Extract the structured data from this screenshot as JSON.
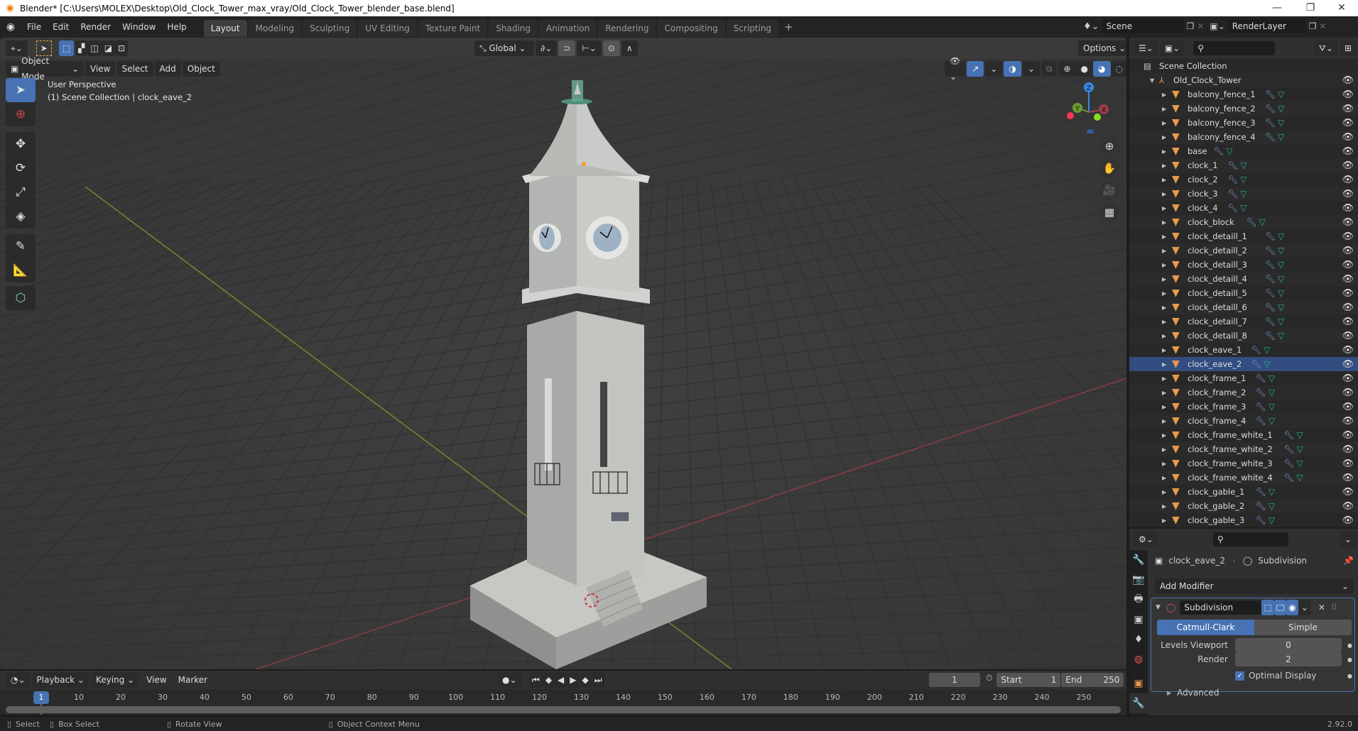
{
  "window": {
    "title": "Blender* [C:\\Users\\MOLEX\\Desktop\\Old_Clock_Tower_max_vray/Old_Clock_Tower_blender_base.blend]",
    "controls": [
      "—",
      "❐",
      "✕"
    ]
  },
  "menu": [
    "File",
    "Edit",
    "Render",
    "Window",
    "Help"
  ],
  "workspaces": [
    {
      "label": "Layout",
      "active": true
    },
    {
      "label": "Modeling"
    },
    {
      "label": "Sculpting"
    },
    {
      "label": "UV Editing"
    },
    {
      "label": "Texture Paint"
    },
    {
      "label": "Shading"
    },
    {
      "label": "Animation"
    },
    {
      "label": "Rendering"
    },
    {
      "label": "Compositing"
    },
    {
      "label": "Scripting"
    }
  ],
  "add_workspace": "+",
  "scene": {
    "name": "Scene",
    "view_layer": "RenderLayer"
  },
  "viewport": {
    "transform_orientation": "Global",
    "options_label": "Options",
    "mode": "Object Mode",
    "header_menus": [
      "View",
      "Select",
      "Add",
      "Object"
    ],
    "overlay_title": "User Perspective",
    "overlay_subtitle": "(1) Scene Collection | clock_eave_2",
    "gizmo_axes": {
      "x": "X",
      "y": "Y",
      "z": "Z"
    },
    "colors": {
      "x_axis": "#a03d4a",
      "y_axis": "#6b9a2f",
      "accent": "#4772b3"
    }
  },
  "tools": [
    "select-box",
    "cursor",
    "move",
    "rotate",
    "scale",
    "transform",
    "annotate",
    "measure",
    "add-cube"
  ],
  "outliner": {
    "root": "Scene Collection",
    "collection": "Old_Clock_Tower",
    "selected": "clock_eave_2",
    "items": [
      "balcony_fence_1",
      "balcony_fence_2",
      "balcony_fence_3",
      "balcony_fence_4",
      "base",
      "clock_1",
      "clock_2",
      "clock_3",
      "clock_4",
      "clock_block",
      "clock_detaill_1",
      "clock_detaill_2",
      "clock_detaill_3",
      "clock_detaill_4",
      "clock_detaill_5",
      "clock_detaill_6",
      "clock_detaill_7",
      "clock_detaill_8",
      "clock_eave_1",
      "clock_eave_2",
      "clock_frame_1",
      "clock_frame_2",
      "clock_frame_3",
      "clock_frame_4",
      "clock_frame_white_1",
      "clock_frame_white_2",
      "clock_frame_white_3",
      "clock_frame_white_4",
      "clock_gable_1",
      "clock_gable_2",
      "clock_gable_3"
    ]
  },
  "properties": {
    "object": "clock_eave_2",
    "modifier_crumb": "Subdivision",
    "add_modifier": "Add Modifier",
    "modifier_name": "Subdivision",
    "type_options": [
      {
        "label": "Catmull-Clark",
        "active": true
      },
      {
        "label": "Simple"
      }
    ],
    "levels_viewport_label": "Levels Viewport",
    "levels_viewport": "0",
    "render_label": "Render",
    "render_levels": "2",
    "optimal_display_label": "Optimal Display",
    "optimal_display": true,
    "advanced_label": "Advanced"
  },
  "timeline": {
    "menus": [
      "Playback",
      "Keying",
      "View",
      "Marker"
    ],
    "current_frame": "1",
    "start_label": "Start",
    "start": "1",
    "end_label": "End",
    "end": "250",
    "ticks": [
      "10",
      "20",
      "30",
      "40",
      "50",
      "60",
      "70",
      "80",
      "90",
      "100",
      "110",
      "120",
      "130",
      "140",
      "150",
      "160",
      "170",
      "180",
      "190",
      "200",
      "210",
      "220",
      "230",
      "240",
      "250"
    ]
  },
  "statusbar": {
    "items": [
      "Select",
      "Box Select",
      "Rotate View",
      "Object Context Menu"
    ],
    "version": "2.92.0"
  }
}
